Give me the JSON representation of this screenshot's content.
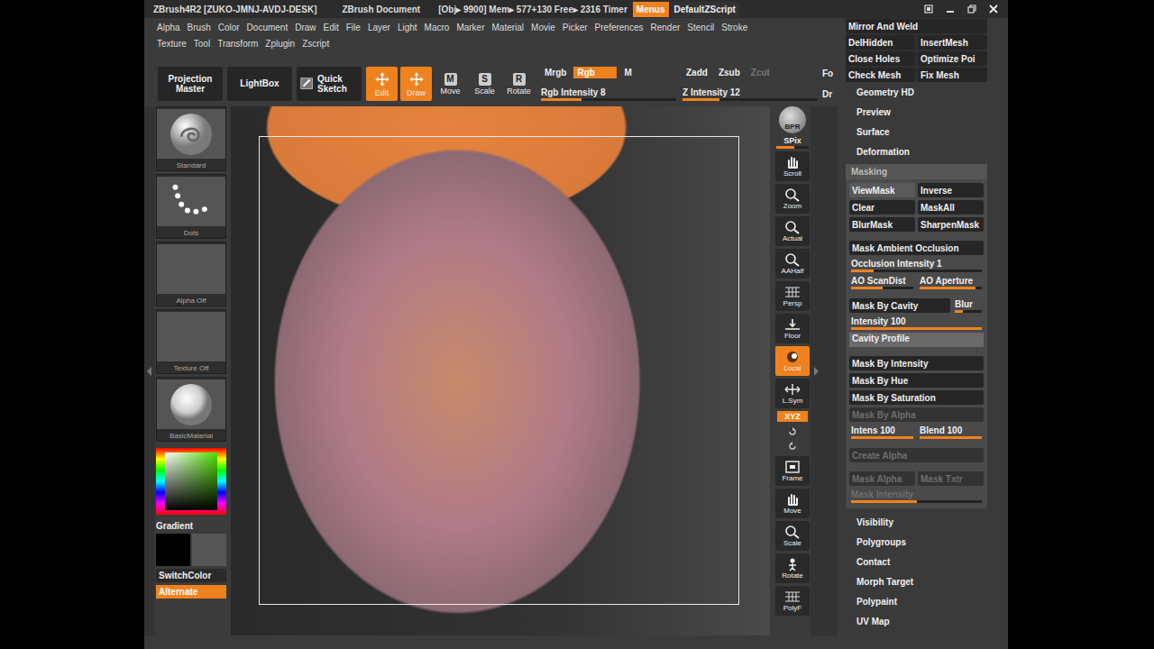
{
  "title_bar": {
    "app": "ZBrush4R2 [ZUKO-JMNJ-AVDJ-DESK]",
    "document": "ZBrush Document",
    "stats": "[Obj▸ 9900] Mem▸ 577+130 Free▸ 2316 Timer",
    "menus_button": {
      "label": "Menus",
      "on": true
    },
    "script": "DefaultZScript"
  },
  "menu_rows": [
    [
      "Alpha",
      "Brush",
      "Color",
      "Document",
      "Draw",
      "Edit",
      "File",
      "Layer",
      "Light",
      "Macro",
      "Marker",
      "Material",
      "Movie",
      "Picker",
      "Preferences",
      "Render",
      "Stencil",
      "Stroke"
    ],
    [
      "Texture",
      "Tool",
      "Transform",
      "Zplugin",
      "Zscript"
    ]
  ],
  "toolbar": {
    "big_buttons": [
      "Projection Master",
      "LightBox"
    ],
    "quick_sketch": {
      "label": "Quick Sketch",
      "on": false
    },
    "modes": [
      {
        "label": "Edit",
        "kind": "icon",
        "on": true
      },
      {
        "label": "Draw",
        "kind": "icon",
        "on": true
      },
      {
        "label": "Move",
        "kind": "key",
        "key": "M",
        "on": false
      },
      {
        "label": "Scale",
        "kind": "key",
        "key": "S",
        "on": false
      },
      {
        "label": "Rotate",
        "kind": "key",
        "key": "R",
        "on": false
      }
    ],
    "rgb": {
      "toggles": [
        {
          "label": "Mrgb",
          "on": false,
          "disabled": false
        },
        {
          "label": "Rgb",
          "on": true,
          "disabled": false
        },
        {
          "label": "M",
          "on": false,
          "disabled": false
        }
      ],
      "slider": {
        "label": "Rgb Intensity 8",
        "level": 0.3
      }
    },
    "z": {
      "toggles": [
        {
          "label": "Zadd",
          "on": false,
          "disabled": false
        },
        {
          "label": "Zsub",
          "on": false,
          "disabled": false
        },
        {
          "label": "Zcut",
          "on": false,
          "disabled": true
        }
      ],
      "slider": {
        "label": "Z Intensity 12",
        "level": 0.27
      }
    },
    "cut": [
      "Fo",
      "Dr"
    ]
  },
  "left_shelf": {
    "thumbs": [
      {
        "label": "Standard",
        "kind": "brush"
      },
      {
        "label": "Dots",
        "kind": "stroke"
      },
      {
        "label": "Alpha Off",
        "kind": "empty"
      },
      {
        "label": "Texture Off",
        "kind": "empty"
      },
      {
        "label": "BasicMaterial",
        "kind": "material"
      }
    ],
    "gradient": "Gradient",
    "switch": "SwitchColor",
    "alternate": {
      "label": "Alternate",
      "on": true
    }
  },
  "right_shelf": [
    {
      "kind": "sphere",
      "label": "BPR"
    },
    {
      "kind": "slider",
      "label": "SPix",
      "level": 0.55
    },
    {
      "kind": "button",
      "label": "Scroll",
      "on": false
    },
    {
      "kind": "button",
      "label": "Zoom",
      "on": false
    },
    {
      "kind": "button",
      "label": "Actual",
      "on": false
    },
    {
      "kind": "button",
      "label": "AAHalf",
      "on": false
    },
    {
      "kind": "button",
      "label": "Persp",
      "on": false
    },
    {
      "kind": "button",
      "label": "Floor",
      "on": false
    },
    {
      "kind": "button",
      "label": "Local",
      "on": true
    },
    {
      "kind": "button",
      "label": "L.Sym",
      "on": false
    },
    {
      "kind": "toggle",
      "label": "XYZ",
      "on": true
    },
    {
      "kind": "icons"
    },
    {
      "kind": "button",
      "label": "Frame",
      "on": false
    },
    {
      "kind": "button",
      "label": "Move",
      "on": false
    },
    {
      "kind": "button",
      "label": "Scale",
      "on": false
    },
    {
      "kind": "button",
      "label": "Rotate",
      "on": false
    },
    {
      "kind": "button",
      "label": "PolyF",
      "on": false
    }
  ],
  "tray": {
    "tool_buttons": [
      [
        "Mirror And Weld"
      ],
      [
        "DelHidden",
        "InsertMesh"
      ],
      [
        "Close Holes",
        "Optimize Poi"
      ],
      [
        "Check Mesh",
        "Fix Mesh"
      ]
    ],
    "sections_above": [
      "Geometry HD",
      "Preview",
      "Surface",
      "Deformation"
    ],
    "masking": {
      "title": "Masking",
      "groups": [
        [
          {
            "kind": "pair",
            "items": [
              {
                "label": "ViewMask",
                "on": true,
                "disabled": false
              },
              {
                "label": "Inverse",
                "on": false,
                "disabled": false
              }
            ]
          },
          {
            "kind": "pair",
            "items": [
              {
                "label": "Clear",
                "on": false,
                "disabled": false
              },
              {
                "label": "MaskAll",
                "on": false,
                "disabled": false
              }
            ]
          },
          {
            "kind": "pair",
            "items": [
              {
                "label": "BlurMask",
                "on": false,
                "disabled": false
              },
              {
                "label": "SharpenMask",
                "on": false,
                "disabled": false
              }
            ]
          }
        ],
        [
          {
            "kind": "wide",
            "label": "Mask Ambient Occlusion",
            "disabled": false
          },
          {
            "kind": "slider",
            "label": "Occlusion Intensity 1",
            "level": 0.17,
            "disabled": false
          },
          {
            "kind": "slider-pair",
            "items": [
              {
                "label": "AO ScanDist",
                "level": 0.5
              },
              {
                "label": "AO Aperture",
                "level": 0.9
              }
            ],
            "disabled": false
          }
        ],
        [
          {
            "kind": "cavity",
            "label": "Mask By Cavity",
            "slider": {
              "label": "Blur",
              "level": 0.3
            },
            "disabled": false
          },
          {
            "kind": "slider",
            "label": "Intensity 100",
            "level": 1,
            "disabled": false
          },
          {
            "kind": "profile",
            "label": "Cavity Profile",
            "disabled": false
          }
        ],
        [
          {
            "kind": "wide",
            "label": "Mask By Intensity",
            "disabled": false
          },
          {
            "kind": "wide",
            "label": "Mask By Hue",
            "disabled": false
          },
          {
            "kind": "wide",
            "label": "Mask By Saturation",
            "disabled": false
          },
          {
            "kind": "wide",
            "label": "Mask By Alpha",
            "disabled": true
          },
          {
            "kind": "slider-pair",
            "items": [
              {
                "label": "Intens 100",
                "level": 1
              },
              {
                "label": "Blend 100",
                "level": 1
              }
            ],
            "disabled": false
          }
        ],
        [
          {
            "kind": "wide",
            "label": "Create Alpha",
            "disabled": true
          }
        ],
        [
          {
            "kind": "pair",
            "items": [
              {
                "label": "Mask Alpha",
                "on": false,
                "disabled": true
              },
              {
                "label": "Mask Txtr",
                "on": false,
                "disabled": true
              }
            ]
          },
          {
            "kind": "slider",
            "label": "Mask Intensity",
            "level": 0.5,
            "disabled": true
          }
        ]
      ]
    },
    "sections_below": [
      "Visibility",
      "Polygroups",
      "Contact",
      "Morph Target",
      "Polypaint",
      "UV Map"
    ]
  }
}
